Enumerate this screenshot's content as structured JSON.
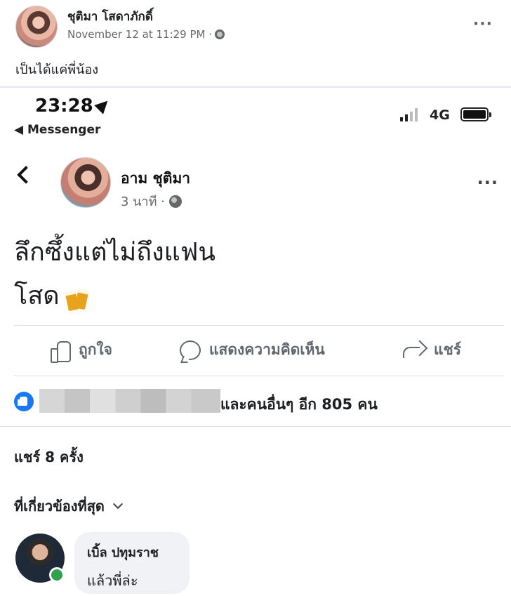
{
  "outer_post": {
    "author": "ชุติมา โสดาภักดิ์",
    "timestamp": "November 12 at 11:29 PM ·",
    "caption": "เป็นได้แค่พี่น้อง",
    "more": "···"
  },
  "status_bar": {
    "time": "23:28",
    "back_app": "◀ Messenger",
    "network": "4G"
  },
  "inner_post": {
    "author": "อาม ชุติมา",
    "timestamp": "3 นาที ·",
    "more": "···",
    "lines": [
      "ลึกซึ้งแต่ไม่ถึงแฟน",
      "โสด"
    ]
  },
  "actions": {
    "like": "ถูกใจ",
    "comment": "แสดงความคิดเห็น",
    "share": "แชร์"
  },
  "reactions": {
    "text": "และคนอื่นๆ อีก 805 คน"
  },
  "shares": "แชร์ 8 ครั้ง",
  "comments_filter": "ที่เกี่ยวข้องที่สุด",
  "comment": {
    "author": "เบิ้ล ปทุมราช",
    "text": "แล้วพี่ล่ะ"
  },
  "colors": {
    "accent": "#1877f2",
    "online": "#31a24c",
    "secondary_text": "#65676b"
  }
}
